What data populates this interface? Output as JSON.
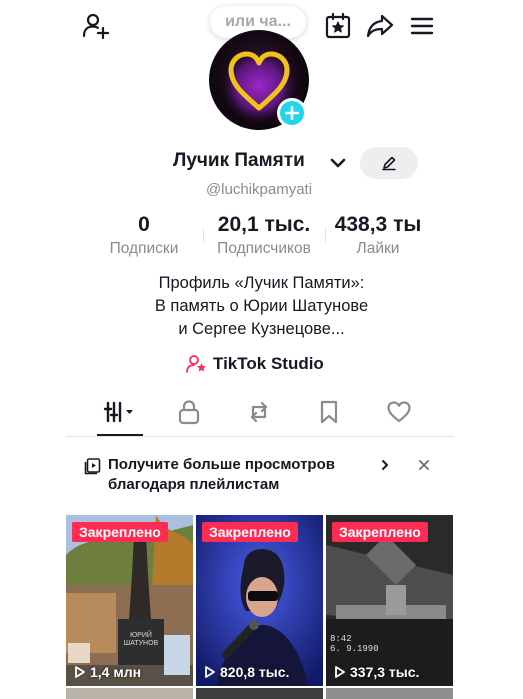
{
  "header": {
    "bubble_text": "или ча...",
    "icons": [
      "add-friend-icon",
      "calendar-star-icon",
      "share-icon",
      "hamburger-menu-icon"
    ]
  },
  "profile": {
    "name": "Лучик Памяти",
    "username": "@luchikpamyati",
    "avatar": "purple-heart-avatar"
  },
  "stats": [
    {
      "value": "0",
      "label": "Подписки"
    },
    {
      "value": "20,1 тыс.",
      "label": "Подписчиков"
    },
    {
      "value": "438,3 ты",
      "label": "Лайки"
    }
  ],
  "bio": {
    "line1": "Профиль «Лучик Памяти»:",
    "line2": "В память о Юрии Шатунове",
    "line3": "и Сергее Кузнецове..."
  },
  "studio": {
    "label": "TikTok Studio"
  },
  "tabs": [
    "videos-grid-icon",
    "lock-icon",
    "repost-icon",
    "bookmark-icon",
    "heart-icon"
  ],
  "playlist_banner": {
    "line1": "Получите больше просмотров",
    "line2": "благодаря плейлистам"
  },
  "videos": [
    {
      "pinned": "Закреплено",
      "views": "1,4 млн",
      "sign_line1": "ЮРИЙ",
      "sign_line2": "ШАТУНОВ"
    },
    {
      "pinned": "Закреплено",
      "views": "820,8 тыс."
    },
    {
      "pinned": "Закреплено",
      "views": "337,3 тыс.",
      "stamp_line1": "8:42",
      "stamp_line2": "6. 9.1990"
    }
  ],
  "colors": {
    "accent": "#fe2c55",
    "badge": "#20d5ec",
    "text": "#161823",
    "muted": "#8a8b91"
  }
}
